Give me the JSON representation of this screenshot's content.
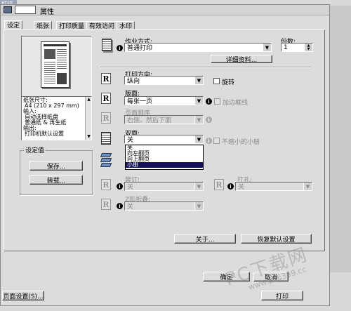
{
  "taskbar": {
    "label": "打印"
  },
  "window": {
    "title": "属性"
  },
  "tabs": [
    {
      "label": "设定"
    },
    {
      "label": "纸张"
    },
    {
      "label": "打印质量"
    },
    {
      "label": "有效访问"
    },
    {
      "label": "水印"
    }
  ],
  "job": {
    "label": "作业方式:",
    "value": "普通打印",
    "details_button": "详细资料..."
  },
  "copies": {
    "label": "份数:",
    "value": "1"
  },
  "orientation": {
    "label": "打印方向:",
    "value": "纵向",
    "rotate_label": "旋转"
  },
  "pages_per_sheet": {
    "label": "版面:",
    "value": "每张一页",
    "border_label": "加边框线"
  },
  "page_order": {
    "label": "页面顺序",
    "value": "右侧，然后下面"
  },
  "duplex": {
    "label": "双面:",
    "value": "关",
    "booklet_label": "不缩小的小册",
    "options": [
      "关",
      "向左翻页",
      "向上翻页",
      "小册"
    ],
    "selected_index": 3
  },
  "staple": {
    "label": "装订:",
    "value": "关"
  },
  "punch": {
    "label": "打孔:",
    "value": "关"
  },
  "fold": {
    "label": "Z形折叠:",
    "value": "关"
  },
  "summary": {
    "lines": [
      "纸张尺寸:",
      "A4 (210 x 297 mm)",
      "输入:",
      "自动选择纸盘",
      "普通纸 & 再生纸",
      "输出:",
      "打印机默认设置"
    ]
  },
  "settings": {
    "group_label": "设定值",
    "save_button": "保存...",
    "load_button": "装载..."
  },
  "about_button": "关于...",
  "restore_button": "恢复默认设置",
  "ok_button": "确定",
  "cancel_button": "取消",
  "print_button": "打印",
  "page_setup_button": "页面设置(S)...",
  "watermark": {
    "text": "PC下载网",
    "url": "www.pc6359.cc"
  },
  "colors": {
    "dialog_bg": "#dcdcdc",
    "selection": "#14125c",
    "disabled_text": "#8a8a8a"
  }
}
